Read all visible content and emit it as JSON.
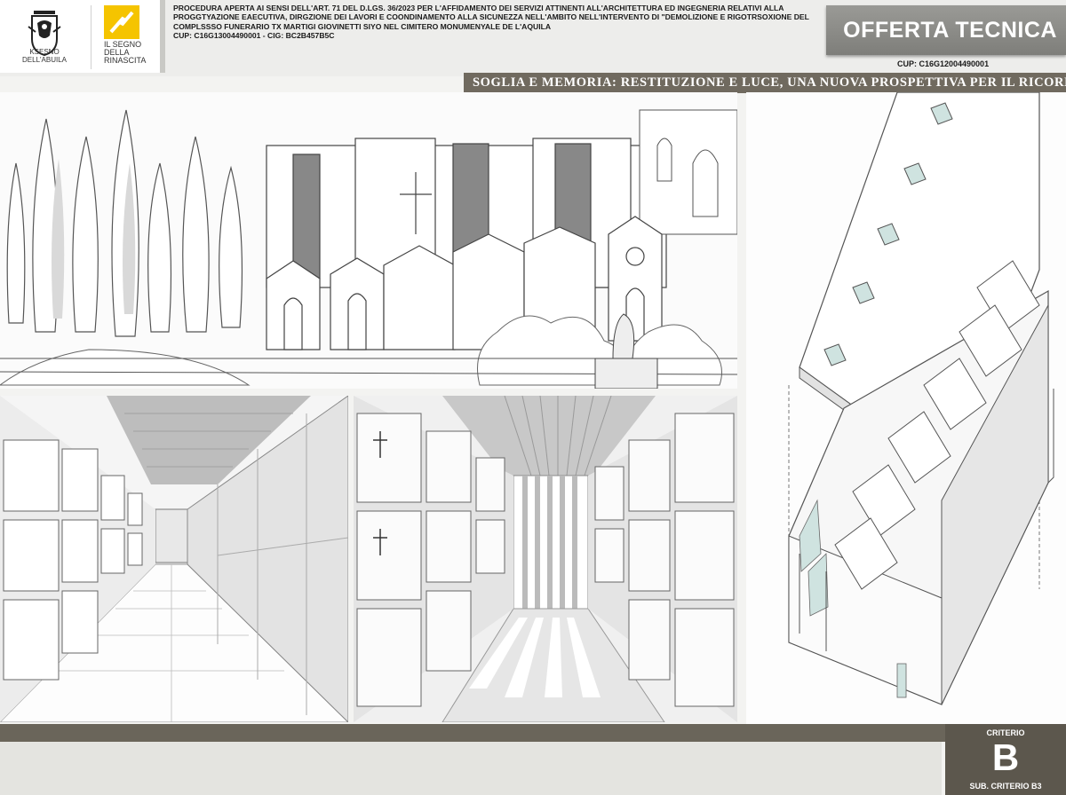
{
  "header": {
    "logo_left_caption": "KSESNO DELL'ABUILA",
    "logo_right_caption": [
      "IL SEGNO",
      "DELLA",
      "RINASCITA"
    ],
    "procedure_text": "PROCEDURA APERTA AI SENSI DELL'ART. 71 DEL D.LGS. 36/2023 PER L'AFFIDAMENTO DEI SERVIZI ATTINENTI ALL'ARCHITETTURA ED INGEGNERIA RELATIVI ALLA PROGGTYAZIONE EAECUTIVA, DIRGZIONE DEI LAVORI E COONDINAMENTO ALLA SICUNEZZA NELL'AMBITO NELL'INTERVENTO DI \"DEMOLIZIONE E RIGOTRSOXIONE DEL COMPLSSSO FUNERARIO TX MARTIGI GIOVINETTI SIYO NEL CIMITERO MONUMENYALE DE L'AQUILA",
    "cup_cig_line": "CUP: C16G13004490001 - CIG: BC2B457B5C",
    "offer_title": "OFFERTA TECNICA",
    "cup_right": "CUP: C16G12004490001"
  },
  "subtitle": "SOGLIA E MEMORIA: RESTITUZIONE E LUCE, UNA NUOVA PROSPETTIVA PER IL RICORDO",
  "footer": {
    "criterion_label": "CRITERIO",
    "criterion_letter": "B",
    "sub_criterion": "SUB. CRITERIO B3"
  },
  "colors": {
    "accent_bar": "#706a5f",
    "offer_box": "#8a8a86",
    "criterion_box": "#5c574d",
    "glass": "#cfe3e0"
  },
  "panels": {
    "cemetery_sketch": "image",
    "corridor_left": "image",
    "corridor_right": "image",
    "axonometry": "image"
  }
}
